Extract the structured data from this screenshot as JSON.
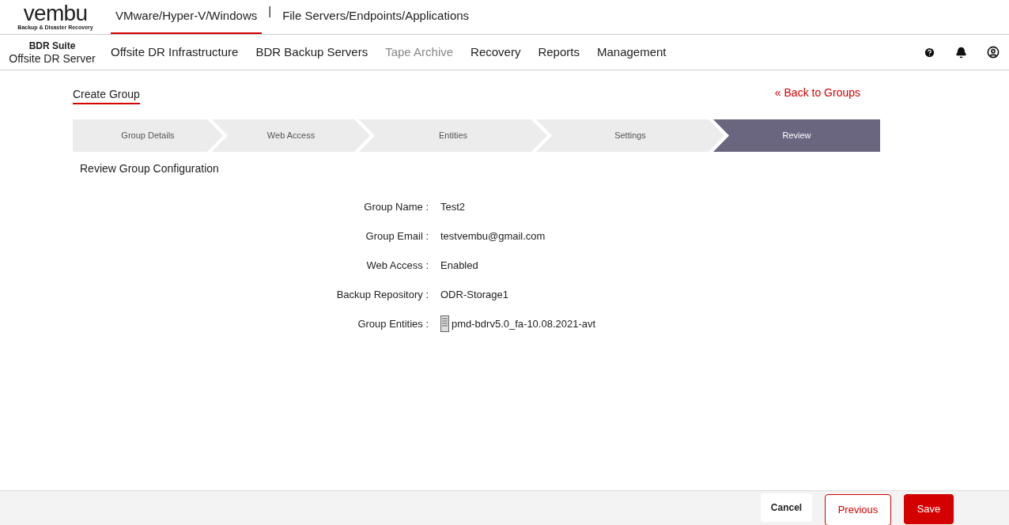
{
  "logo": {
    "wordmark": "vembu",
    "tagline": "Backup & Disaster Recovery"
  },
  "top_tabs": [
    {
      "label": "VMware/Hyper-V/Windows",
      "selected": true
    },
    {
      "label": "File Servers/Endpoints/Applications",
      "selected": false
    }
  ],
  "top_separator": "|",
  "product": {
    "suite": "BDR Suite",
    "name": "Offsite DR Server"
  },
  "nav": [
    {
      "label": "Offsite DR Infrastructure",
      "disabled": false
    },
    {
      "label": "BDR Backup Servers",
      "disabled": false
    },
    {
      "label": "Tape Archive",
      "disabled": true
    },
    {
      "label": "Recovery",
      "disabled": false
    },
    {
      "label": "Reports",
      "disabled": false
    },
    {
      "label": "Management",
      "disabled": false
    }
  ],
  "page_title": "Create Group",
  "back_link": "« Back to Groups",
  "steps": [
    {
      "label": "Group Details",
      "selected": false
    },
    {
      "label": "Web Access",
      "selected": false
    },
    {
      "label": "Entities",
      "selected": false
    },
    {
      "label": "Settings",
      "selected": false
    },
    {
      "label": "Review",
      "selected": true
    }
  ],
  "section_title": "Review Group Configuration",
  "fields": [
    {
      "label": "Group Name :",
      "value": "Test2",
      "kind": "text"
    },
    {
      "label": "Group Email :",
      "value": "testvembu@gmail.com",
      "kind": "text"
    },
    {
      "label": "Web Access :",
      "value": "Enabled",
      "kind": "text"
    },
    {
      "label": "Backup Repository :",
      "value": "ODR-Storage1",
      "kind": "text"
    },
    {
      "label": "Group Entities :",
      "value": "pmd-bdrv5.0_fa-10.08.2021-avt",
      "kind": "server"
    }
  ],
  "buttons": {
    "cancel": "Cancel",
    "previous": "Previous",
    "save": "Save"
  }
}
